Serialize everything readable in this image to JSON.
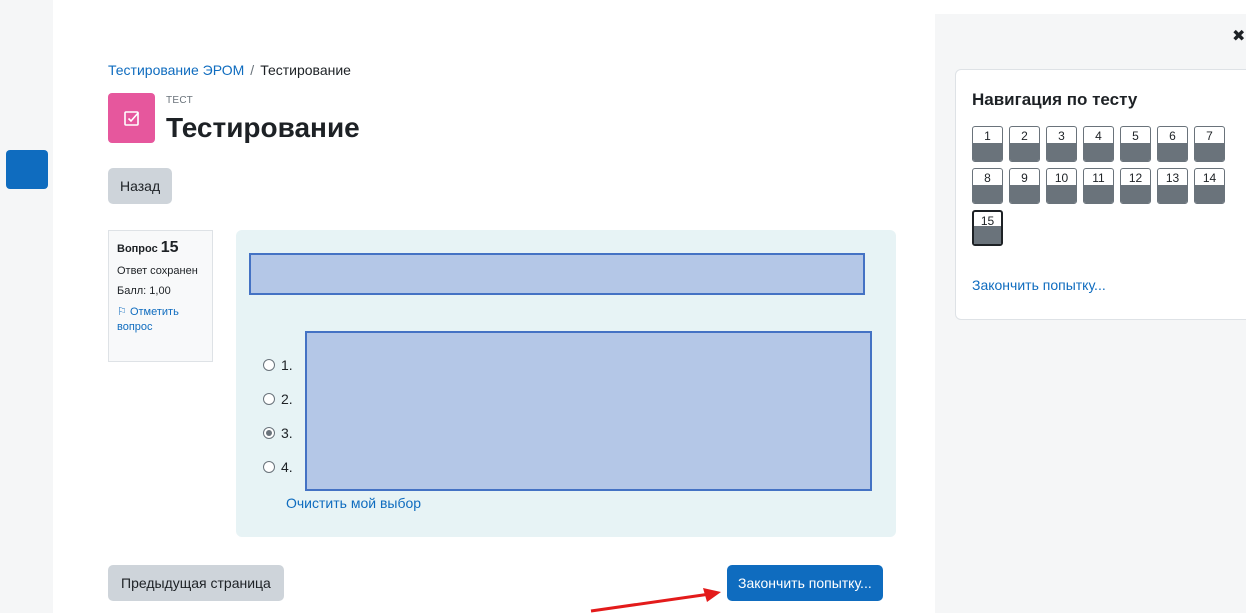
{
  "breadcrumb": {
    "course": "Тестирование ЭРОМ",
    "separator": "/",
    "current": "Тестирование"
  },
  "module": {
    "type_label": "ТЕСТ",
    "title": "Тестирование",
    "icon": "quiz-checkbox-icon",
    "icon_color": "#e6579d"
  },
  "buttons": {
    "back": "Назад",
    "prev_page": "Предыдущая страница",
    "finish": "Закончить попытку..."
  },
  "question": {
    "number_prefix": "Вопрос",
    "number": "15",
    "state": "Ответ сохранен",
    "grade": "Балл: 1,00",
    "flag": "Отметить вопрос",
    "options": [
      {
        "label": "1.",
        "selected": false
      },
      {
        "label": "2.",
        "selected": false
      },
      {
        "label": "3.",
        "selected": true
      },
      {
        "label": "4.",
        "selected": false
      }
    ],
    "clear": "Очистить мой выбор"
  },
  "navigation": {
    "title": "Навигация по тесту",
    "questions": [
      "1",
      "2",
      "3",
      "4",
      "5",
      "6",
      "7",
      "8",
      "9",
      "10",
      "11",
      "12",
      "13",
      "14",
      "15"
    ],
    "current": "15",
    "finish_link": "Закончить попытку..."
  },
  "colors": {
    "primary": "#0f6cbf",
    "answered": "#6a737b",
    "redaction_fill": "#b4c7e7",
    "redaction_border": "#4472c4",
    "annotation_arrow": "#e31b1b"
  }
}
